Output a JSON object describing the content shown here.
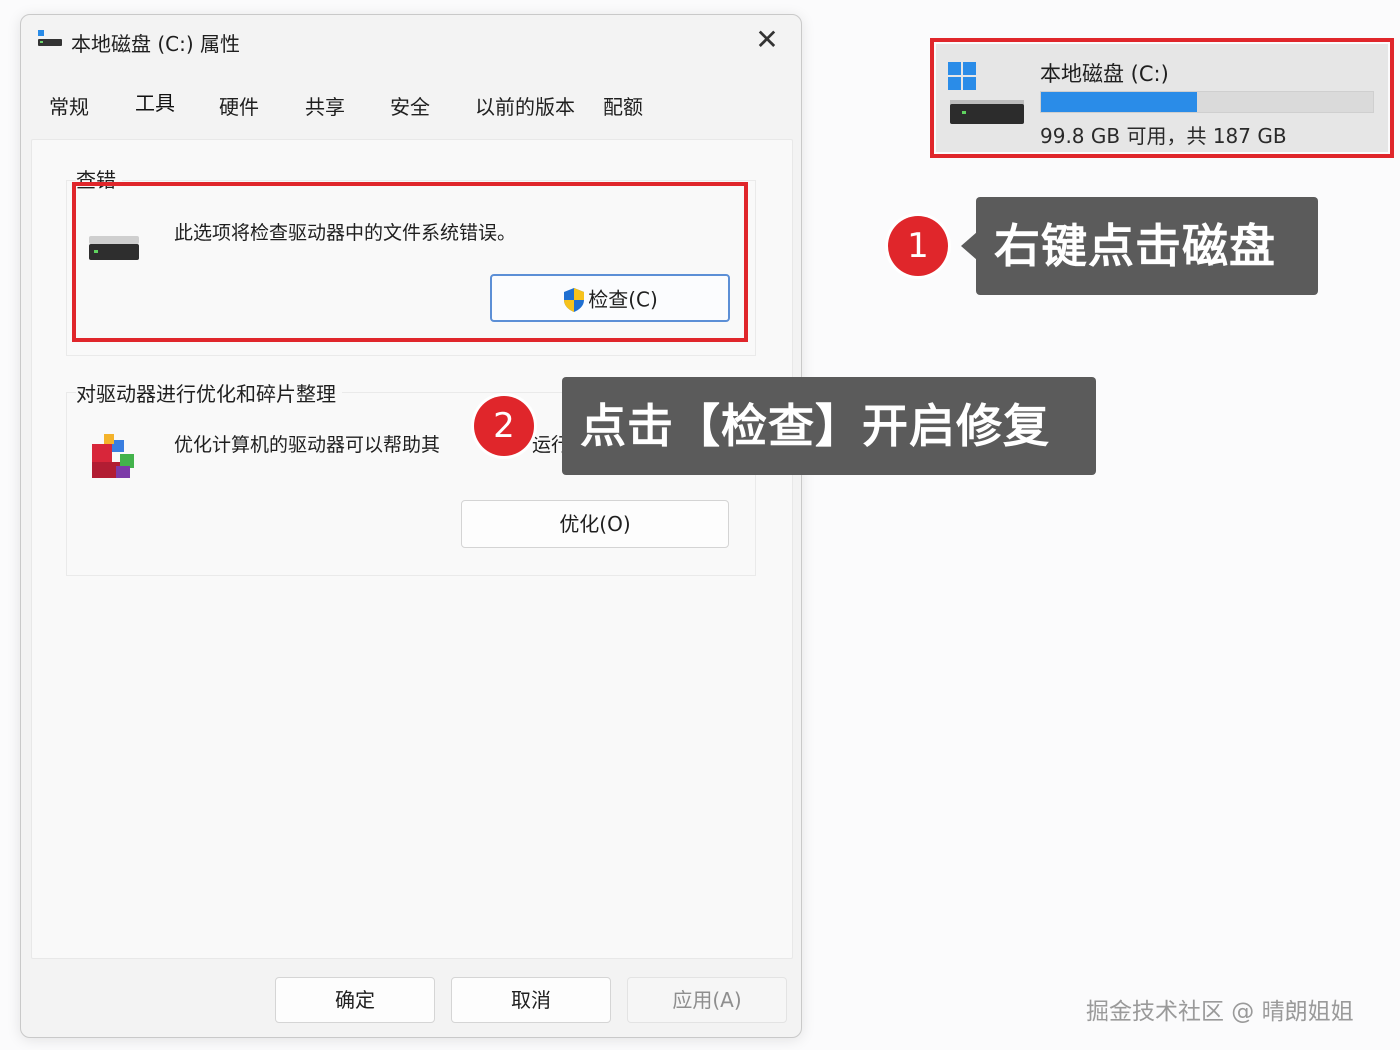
{
  "dialog": {
    "title": "本地磁盘 (C:) 属性",
    "close_glyph": "✕",
    "tabs": [
      {
        "label": "常规"
      },
      {
        "label": "工具"
      },
      {
        "label": "硬件"
      },
      {
        "label": "共享"
      },
      {
        "label": "安全"
      },
      {
        "label": "以前的版本"
      },
      {
        "label": "配额"
      }
    ],
    "active_tab": "工具",
    "error_check": {
      "title": "查错",
      "description": "此选项将检查驱动器中的文件系统错误。",
      "button_label": "检查(C)",
      "button_icon": "uac-shield-icon"
    },
    "optimize": {
      "title": "对驱动器进行优化和碎片整理",
      "description_left": "优化计算机的驱动器可以帮助其",
      "description_right": "运行",
      "button_label": "优化(O)",
      "icon": "defrag-icon"
    },
    "footer": {
      "ok_label": "确定",
      "cancel_label": "取消",
      "apply_label": "应用(A)"
    }
  },
  "drive_card": {
    "name": "本地磁盘 (C:)",
    "size_text": "99.8 GB 可用，共 187 GB",
    "used_fraction": 0.47,
    "bar_color": "#2a8ce8",
    "icon": "windows-drive-icon"
  },
  "annotations": {
    "step1_number": "1",
    "step1_text": "右键点击磁盘",
    "step2_number": "2",
    "step2_text": "点击【检查】开启修复",
    "highlight_color": "#e0262b"
  },
  "watermark": "掘金技术社区 @ 晴朗姐姐"
}
